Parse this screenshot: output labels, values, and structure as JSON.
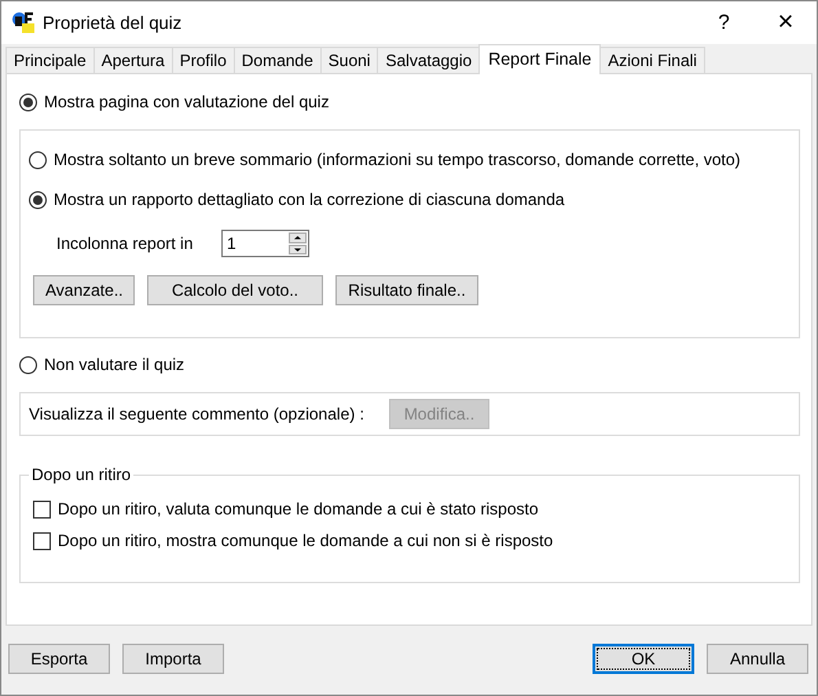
{
  "window": {
    "title": "Proprietà del quiz",
    "help": "?",
    "close": "×"
  },
  "tabs": [
    {
      "label": "Principale",
      "selected": false
    },
    {
      "label": "Apertura",
      "selected": false
    },
    {
      "label": "Profilo",
      "selected": false
    },
    {
      "label": "Domande",
      "selected": false
    },
    {
      "label": "Suoni",
      "selected": false
    },
    {
      "label": "Salvataggio",
      "selected": false
    },
    {
      "label": "Report Finale",
      "selected": true
    },
    {
      "label": "Azioni Finali",
      "selected": false
    }
  ],
  "evaluate_option": {
    "label": "Mostra pagina con valutazione del quiz",
    "selected": true
  },
  "evaluation_group": {
    "options": [
      {
        "label": "Mostra soltanto un breve sommario (informazioni su tempo trascorso, domande corrette, voto)",
        "selected": false
      },
      {
        "label": "Mostra un rapporto dettagliato con la correzione di ciascuna domanda",
        "selected": true
      }
    ],
    "columns": {
      "label": "Incolonna report in",
      "value": "1"
    },
    "buttons": [
      "Avanzate..",
      "Calcolo del voto..",
      "Risultato finale.."
    ]
  },
  "no_evaluation_option": {
    "label": "Non valutare il quiz",
    "selected": false
  },
  "comment": {
    "label": "Visualizza il seguente commento (opzionale) :",
    "button": {
      "label": "Modifica..",
      "disabled": true
    }
  },
  "after_withdrawal": {
    "title": "Dopo un ritiro",
    "checkboxes": [
      {
        "label": "Dopo un ritiro, valuta comunque le domande a cui è stato risposto",
        "checked": false
      },
      {
        "label": "Dopo un ritiro, mostra comunque le domande a cui non si è risposto",
        "checked": false
      }
    ]
  },
  "footer": {
    "left_buttons": [
      {
        "label": "Esporta",
        "default": false
      },
      {
        "label": "Importa",
        "default": false
      }
    ],
    "right_buttons": [
      {
        "label": "OK",
        "default": true
      },
      {
        "label": "Annulla",
        "default": false
      }
    ]
  }
}
